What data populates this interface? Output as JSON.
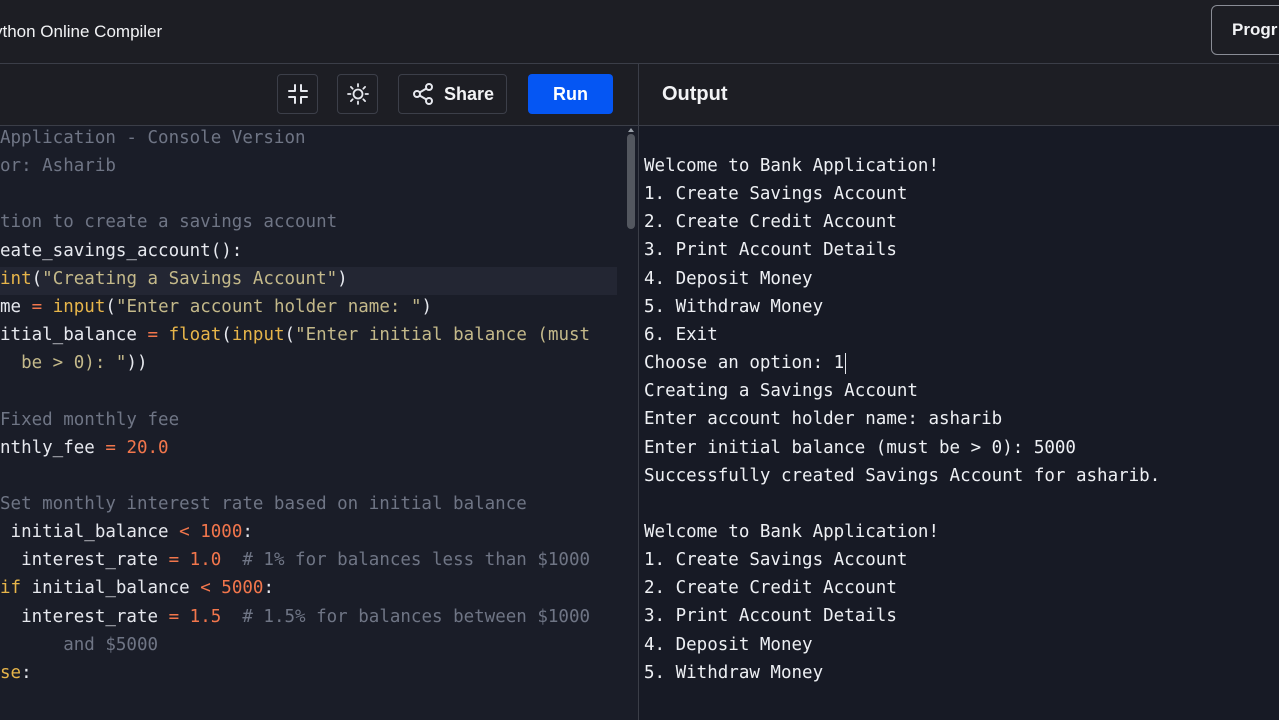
{
  "header": {
    "title": "ython Online Compiler",
    "pro_button": "Progr"
  },
  "toolbar": {
    "fullscreen_icon": "collapse-icon",
    "theme_icon": "sun-icon",
    "share_label": "Share",
    "run_label": "Run",
    "output_label": "Output"
  },
  "colors": {
    "accent": "#0556f3",
    "comment": "#6f7585",
    "keyword": "#e7b54a",
    "string": "#c4b98a",
    "number": "#f2764c",
    "operator": "#f2764c",
    "plain": "#e6e8ee"
  },
  "editor": {
    "lines": [
      [
        {
          "t": "Application - Console Version",
          "c": "comment"
        }
      ],
      [
        {
          "t": "or: Asharib",
          "c": "comment"
        }
      ],
      [],
      [
        {
          "t": "tion to create a savings account",
          "c": "comment"
        }
      ],
      [
        {
          "t": "eate_savings_account():",
          "c": "plain"
        }
      ],
      [
        {
          "t": "int",
          "c": "keyword"
        },
        {
          "t": "(",
          "c": "plain"
        },
        {
          "t": "\"Creating a Savings Account\"",
          "c": "string"
        },
        {
          "t": ")",
          "c": "plain"
        }
      ],
      [
        {
          "t": "me ",
          "c": "plain"
        },
        {
          "t": "=",
          "c": "operator"
        },
        {
          "t": " ",
          "c": "plain"
        },
        {
          "t": "input",
          "c": "keyword"
        },
        {
          "t": "(",
          "c": "plain"
        },
        {
          "t": "\"Enter account holder name: \"",
          "c": "string"
        },
        {
          "t": ")",
          "c": "plain"
        }
      ],
      [
        {
          "t": "itial_balance ",
          "c": "plain"
        },
        {
          "t": "=",
          "c": "operator"
        },
        {
          "t": " ",
          "c": "plain"
        },
        {
          "t": "float",
          "c": "keyword"
        },
        {
          "t": "(",
          "c": "plain"
        },
        {
          "t": "input",
          "c": "keyword"
        },
        {
          "t": "(",
          "c": "plain"
        },
        {
          "t": "\"Enter initial balance (must",
          "c": "string"
        }
      ],
      [
        {
          "t": "  be > 0): \"",
          "c": "string"
        },
        {
          "t": "))",
          "c": "plain"
        }
      ],
      [],
      [
        {
          "t": "Fixed monthly fee",
          "c": "comment"
        }
      ],
      [
        {
          "t": "nthly_fee ",
          "c": "plain"
        },
        {
          "t": "=",
          "c": "operator"
        },
        {
          "t": " ",
          "c": "plain"
        },
        {
          "t": "20.0",
          "c": "number"
        }
      ],
      [],
      [
        {
          "t": "Set monthly interest rate based on initial balance",
          "c": "comment"
        }
      ],
      [
        {
          "t": " initial_balance ",
          "c": "plain"
        },
        {
          "t": "<",
          "c": "operator"
        },
        {
          "t": " ",
          "c": "plain"
        },
        {
          "t": "1000",
          "c": "number"
        },
        {
          "t": ":",
          "c": "plain"
        }
      ],
      [
        {
          "t": "  interest_rate ",
          "c": "plain"
        },
        {
          "t": "=",
          "c": "operator"
        },
        {
          "t": " ",
          "c": "plain"
        },
        {
          "t": "1.0",
          "c": "number"
        },
        {
          "t": "  # 1% for balances less than $1000",
          "c": "comment"
        }
      ],
      [
        {
          "t": "if",
          "c": "keyword"
        },
        {
          "t": " initial_balance ",
          "c": "plain"
        },
        {
          "t": "<",
          "c": "operator"
        },
        {
          "t": " ",
          "c": "plain"
        },
        {
          "t": "5000",
          "c": "number"
        },
        {
          "t": ":",
          "c": "plain"
        }
      ],
      [
        {
          "t": "  interest_rate ",
          "c": "plain"
        },
        {
          "t": "=",
          "c": "operator"
        },
        {
          "t": " ",
          "c": "plain"
        },
        {
          "t": "1.5",
          "c": "number"
        },
        {
          "t": "  # 1.5% for balances between $1000",
          "c": "comment"
        }
      ],
      [
        {
          "t": "      and $5000",
          "c": "comment"
        }
      ],
      [
        {
          "t": "se",
          "c": "keyword"
        },
        {
          "t": ":",
          "c": "plain"
        }
      ]
    ]
  },
  "output": {
    "lines": [
      "Welcome to Bank Application!",
      "1. Create Savings Account",
      "2. Create Credit Account",
      "3. Print Account Details",
      "4. Deposit Money",
      "5. Withdraw Money",
      "6. Exit",
      "Choose an option: 1",
      "Creating a Savings Account",
      "Enter account holder name: asharib",
      "Enter initial balance (must be > 0): 5000",
      "Successfully created Savings Account for asharib.",
      "",
      "Welcome to Bank Application!",
      "1. Create Savings Account",
      "2. Create Credit Account",
      "3. Print Account Details",
      "4. Deposit Money",
      "5. Withdraw Money"
    ]
  }
}
